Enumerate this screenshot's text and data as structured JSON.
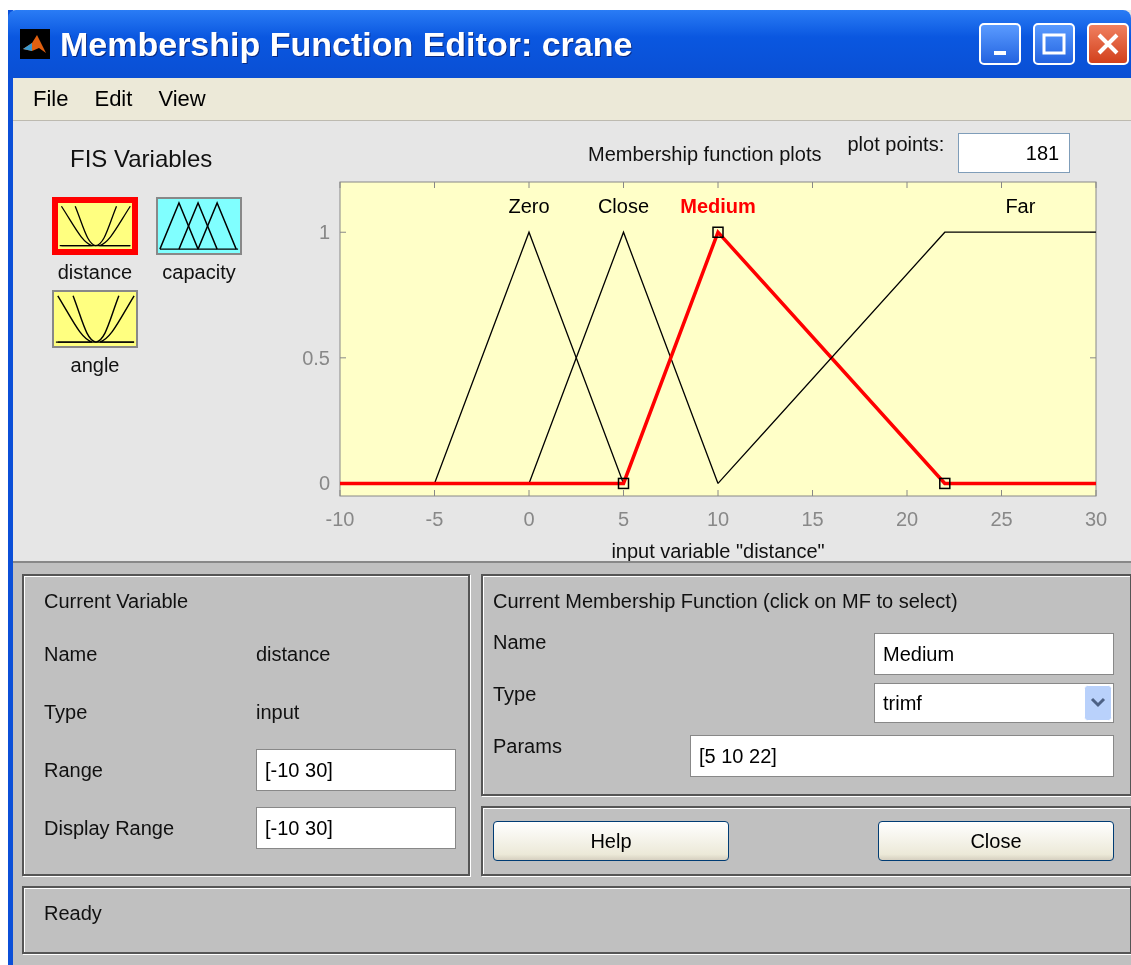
{
  "window": {
    "title": "Membership Function Editor: crane"
  },
  "menu": [
    "File",
    "Edit",
    "View"
  ],
  "fis_variables": {
    "title": "FIS Variables",
    "items": [
      {
        "name": "distance",
        "kind": "input",
        "selected": true
      },
      {
        "name": "capacity",
        "kind": "output",
        "selected": false
      },
      {
        "name": "angle",
        "kind": "input",
        "selected": false
      }
    ]
  },
  "plot": {
    "title": "Membership function plots",
    "plot_points": {
      "label": "plot points:",
      "value": "181"
    },
    "chart_data": {
      "type": "line",
      "xlabel": "input variable \"distance\"",
      "x": [
        -10,
        -5,
        0,
        5,
        10,
        22,
        30
      ],
      "series": [
        {
          "name": "Zero",
          "color": "#000000",
          "values": [
            null,
            0,
            1,
            0,
            null,
            null,
            null
          ]
        },
        {
          "name": "Close",
          "color": "#000000",
          "values": [
            null,
            null,
            0,
            1,
            0,
            null,
            null
          ]
        },
        {
          "name": "Medium",
          "color": "#ff0000",
          "values": [
            0,
            0,
            0,
            0,
            1,
            0,
            0
          ]
        },
        {
          "name": "Far",
          "color": "#000000",
          "values": [
            null,
            null,
            null,
            null,
            0,
            1,
            1
          ]
        }
      ],
      "xlim": [
        -10,
        30
      ],
      "ylim": [
        -0.05,
        1.2
      ],
      "xticks": [
        -10,
        -5,
        0,
        5,
        10,
        15,
        20,
        25,
        30
      ],
      "yticks": [
        0,
        0.5,
        1
      ]
    },
    "functions": [
      {
        "selected": false
      },
      {
        "selected": false
      },
      {
        "selected": true
      },
      {
        "selected": false
      }
    ]
  },
  "current_variable": {
    "title": "Current Variable",
    "fields": [
      {
        "label": "Name",
        "value": "distance",
        "kind": "text"
      },
      {
        "label": "Type",
        "value": "input",
        "kind": "text"
      },
      {
        "label": "Range",
        "value": "[-10 30]",
        "kind": "input"
      },
      {
        "label": "Display Range",
        "value": "[-10 30]",
        "kind": "input"
      }
    ]
  },
  "current_mf": {
    "title": "Current Membership Function (click on MF to select)",
    "name": {
      "label": "Name",
      "value": "Medium"
    },
    "type": {
      "label": "Type",
      "value": "trimf"
    },
    "params": {
      "label": "Params",
      "value": "[5 10 22]"
    }
  },
  "buttons": [
    "Help",
    "Close"
  ],
  "status": "Ready"
}
